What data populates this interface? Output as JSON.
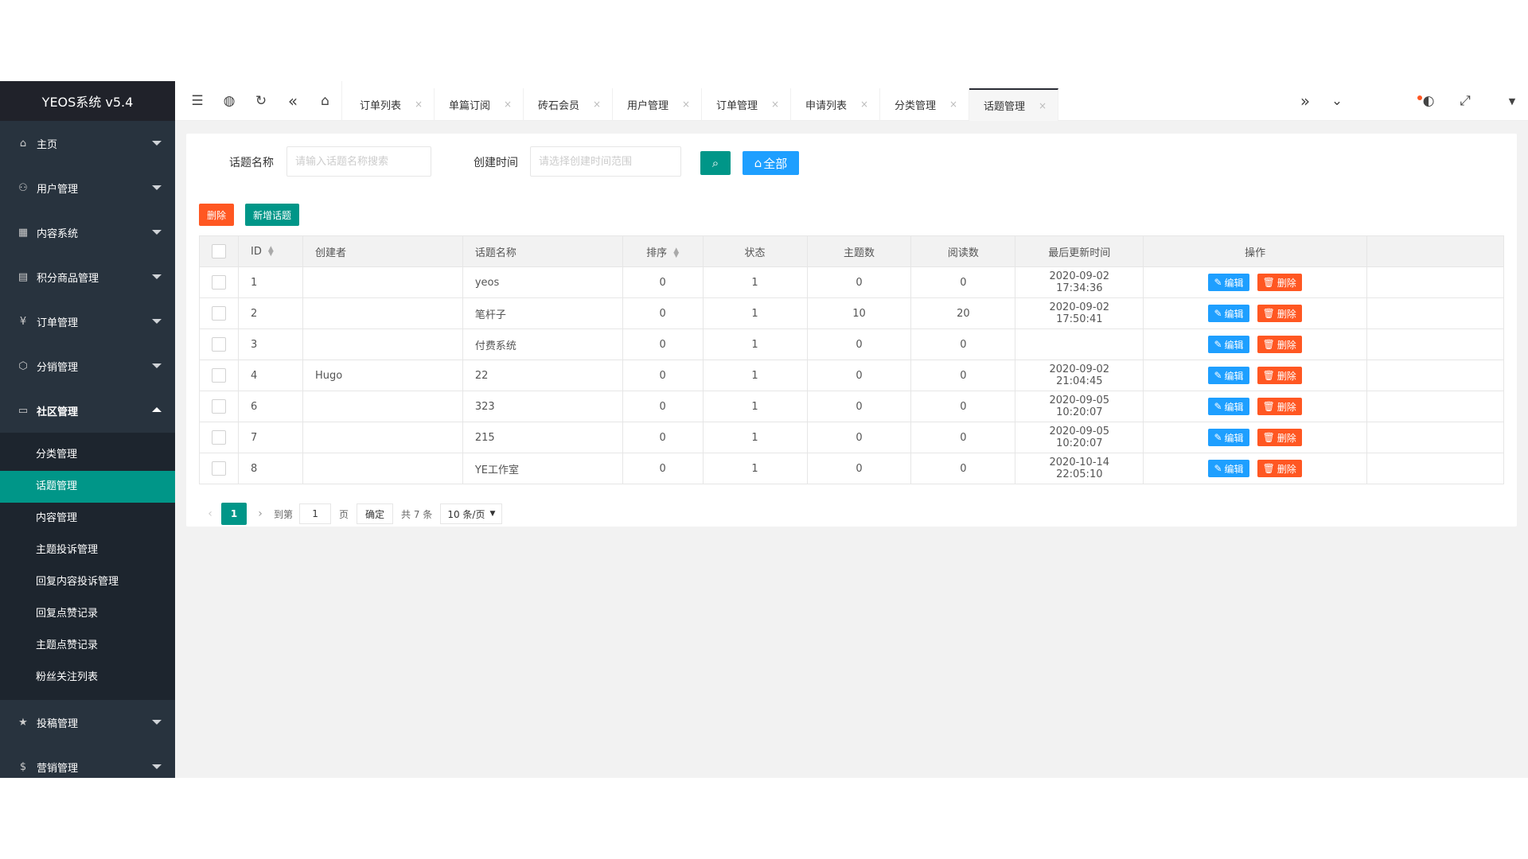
{
  "app": {
    "title": "YEOS系统 v5.4"
  },
  "sidebar": {
    "items": [
      {
        "label": "主页",
        "icon": "⌂",
        "open": false
      },
      {
        "label": "用户管理",
        "icon": "⚇",
        "open": false
      },
      {
        "label": "内容系统",
        "icon": "▦",
        "open": false
      },
      {
        "label": "积分商品管理",
        "icon": "▤",
        "open": false
      },
      {
        "label": "订单管理",
        "icon": "¥",
        "open": false
      },
      {
        "label": "分销管理",
        "icon": "⬡",
        "open": false
      },
      {
        "label": "社区管理",
        "icon": "▭",
        "open": true
      },
      {
        "label": "投稿管理",
        "icon": "★",
        "open": false
      },
      {
        "label": "营销管理",
        "icon": "$",
        "open": false
      }
    ],
    "community_sub": [
      "分类管理",
      "话题管理",
      "内容管理",
      "主题投诉管理",
      "回复内容投诉管理",
      "回复点赞记录",
      "主题点赞记录",
      "粉丝关注列表"
    ],
    "active_sub": "话题管理"
  },
  "tabs": [
    "订单列表",
    "单篇订阅",
    "砖石会员",
    "用户管理",
    "订单管理",
    "申请列表",
    "分类管理",
    "话题管理"
  ],
  "active_tab": "话题管理",
  "search": {
    "name_label": "话题名称",
    "name_placeholder": "请输入话题名称搜索",
    "time_label": "创建时间",
    "time_placeholder": "请选择创建时间范围",
    "all_label": "全部"
  },
  "actions": {
    "delete": "删除",
    "add": "新增话题"
  },
  "table": {
    "headers": [
      "ID",
      "创建者",
      "话题名称",
      "排序",
      "状态",
      "主题数",
      "阅读数",
      "最后更新时间",
      "操作"
    ],
    "edit_label": "编辑",
    "delete_label": "删除",
    "rows": [
      {
        "id": "1",
        "creator": "",
        "name": "yeos",
        "sort": "0",
        "status": "1",
        "topics": "0",
        "reads": "0",
        "updated": "2020-09-02 17:34:36"
      },
      {
        "id": "2",
        "creator": "",
        "name": "笔杆子",
        "sort": "0",
        "status": "1",
        "topics": "10",
        "reads": "20",
        "updated": "2020-09-02 17:50:41"
      },
      {
        "id": "3",
        "creator": "",
        "name": "付费系统",
        "sort": "0",
        "status": "1",
        "topics": "0",
        "reads": "0",
        "updated": ""
      },
      {
        "id": "4",
        "creator": "Hugo",
        "name": "22",
        "sort": "0",
        "status": "1",
        "topics": "0",
        "reads": "0",
        "updated": "2020-09-02 21:04:45"
      },
      {
        "id": "6",
        "creator": "",
        "name": "323",
        "sort": "0",
        "status": "1",
        "topics": "0",
        "reads": "0",
        "updated": "2020-09-05 10:20:07"
      },
      {
        "id": "7",
        "creator": "",
        "name": "215",
        "sort": "0",
        "status": "1",
        "topics": "0",
        "reads": "0",
        "updated": "2020-09-05 10:20:07"
      },
      {
        "id": "8",
        "creator": "",
        "name": "YE工作室",
        "sort": "0",
        "status": "1",
        "topics": "0",
        "reads": "0",
        "updated": "2020-10-14 22:05:10"
      }
    ]
  },
  "pager": {
    "current": "1",
    "goto_label": "到第",
    "page_input": "1",
    "page_unit": "页",
    "confirm": "确定",
    "total": "共 7 条",
    "per_page": "10 条/页"
  },
  "colors": {
    "primary": "#009688",
    "blue": "#1e9fff",
    "danger": "#ff5722",
    "sidebar_bg": "#28333e"
  }
}
